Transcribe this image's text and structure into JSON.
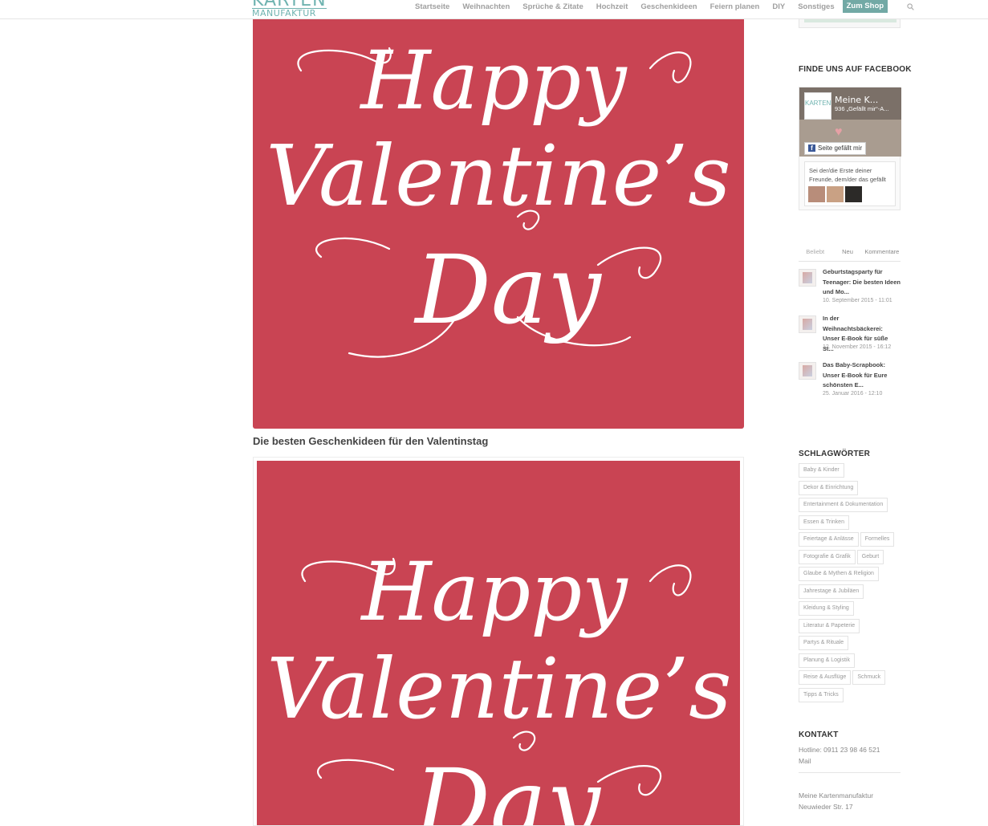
{
  "header": {
    "logo_line1": "KARTEN",
    "logo_line2": "MANUFAKTUR",
    "nav": [
      "Startseite",
      "Weihnachten",
      "Sprüche & Zitate",
      "Hochzeit",
      "Geschenkideen",
      "Feiern planen",
      "DIY",
      "Sonstiges"
    ],
    "shop_label": "Zum Shop"
  },
  "main": {
    "hero_lettering": [
      "Happy",
      "Valentine’s",
      "Day"
    ],
    "caption": "Die besten Geschenkideen für den Valentinstag",
    "card_lettering": [
      "Happy",
      "Valentine’s",
      "Day"
    ]
  },
  "sidebar": {
    "facebook": {
      "title": "FINDE UNS AUF FACEBOOK",
      "page_name": "Meine K...",
      "likes": "936 „Gefällt mir“-A...",
      "like_button": "Seite gefällt mir",
      "friends_text": "Sei der/die Erste deiner Freunde, dem/der das gefällt",
      "logo_text": "KARTEN"
    },
    "tabs": [
      "Beliebt",
      "Neu",
      "Kommentare"
    ],
    "posts": [
      {
        "title": "Geburtstagsparty für Teenager: Die besten Ideen und Mo...",
        "date": "10. September 2015 - 11:01"
      },
      {
        "title": "In der Weihnachtsbäckerei: Unser E-Book für süße St...",
        "date": "12. November 2015 - 16:12"
      },
      {
        "title": "Das Baby-Scrapbook: Unser E-Book für Eure schönsten E...",
        "date": "25. Januar 2016 - 12:10"
      }
    ],
    "tags_title": "SCHLAGWÖRTER",
    "tags": [
      "Baby & Kinder",
      "Dekor & Einrichtung",
      "Entertainment & Dokumentation",
      "Essen & Trinken",
      "Feiertage & Anlässe",
      "Formelles",
      "Fotografie & Grafik",
      "Geburt",
      "Glaube & Mythen & Religion",
      "Jahrestage & Jubiläen",
      "Kleidung & Styling",
      "Literatur & Papeterie",
      "Partys & Rituale",
      "Planung & Logistik",
      "Reise & Ausflüge",
      "Schmuck",
      "Tipps & Tricks"
    ],
    "contact": {
      "title": "KONTAKT",
      "hotline": "Hotline: 0911 23 98 46 521",
      "mail": "Mail",
      "company": "Meine Kartenmanufaktur",
      "street": "Neuwieder Str. 17"
    },
    "colors": {
      "valentine_red": "#c94453",
      "brand_teal": "#72a9a5"
    }
  }
}
